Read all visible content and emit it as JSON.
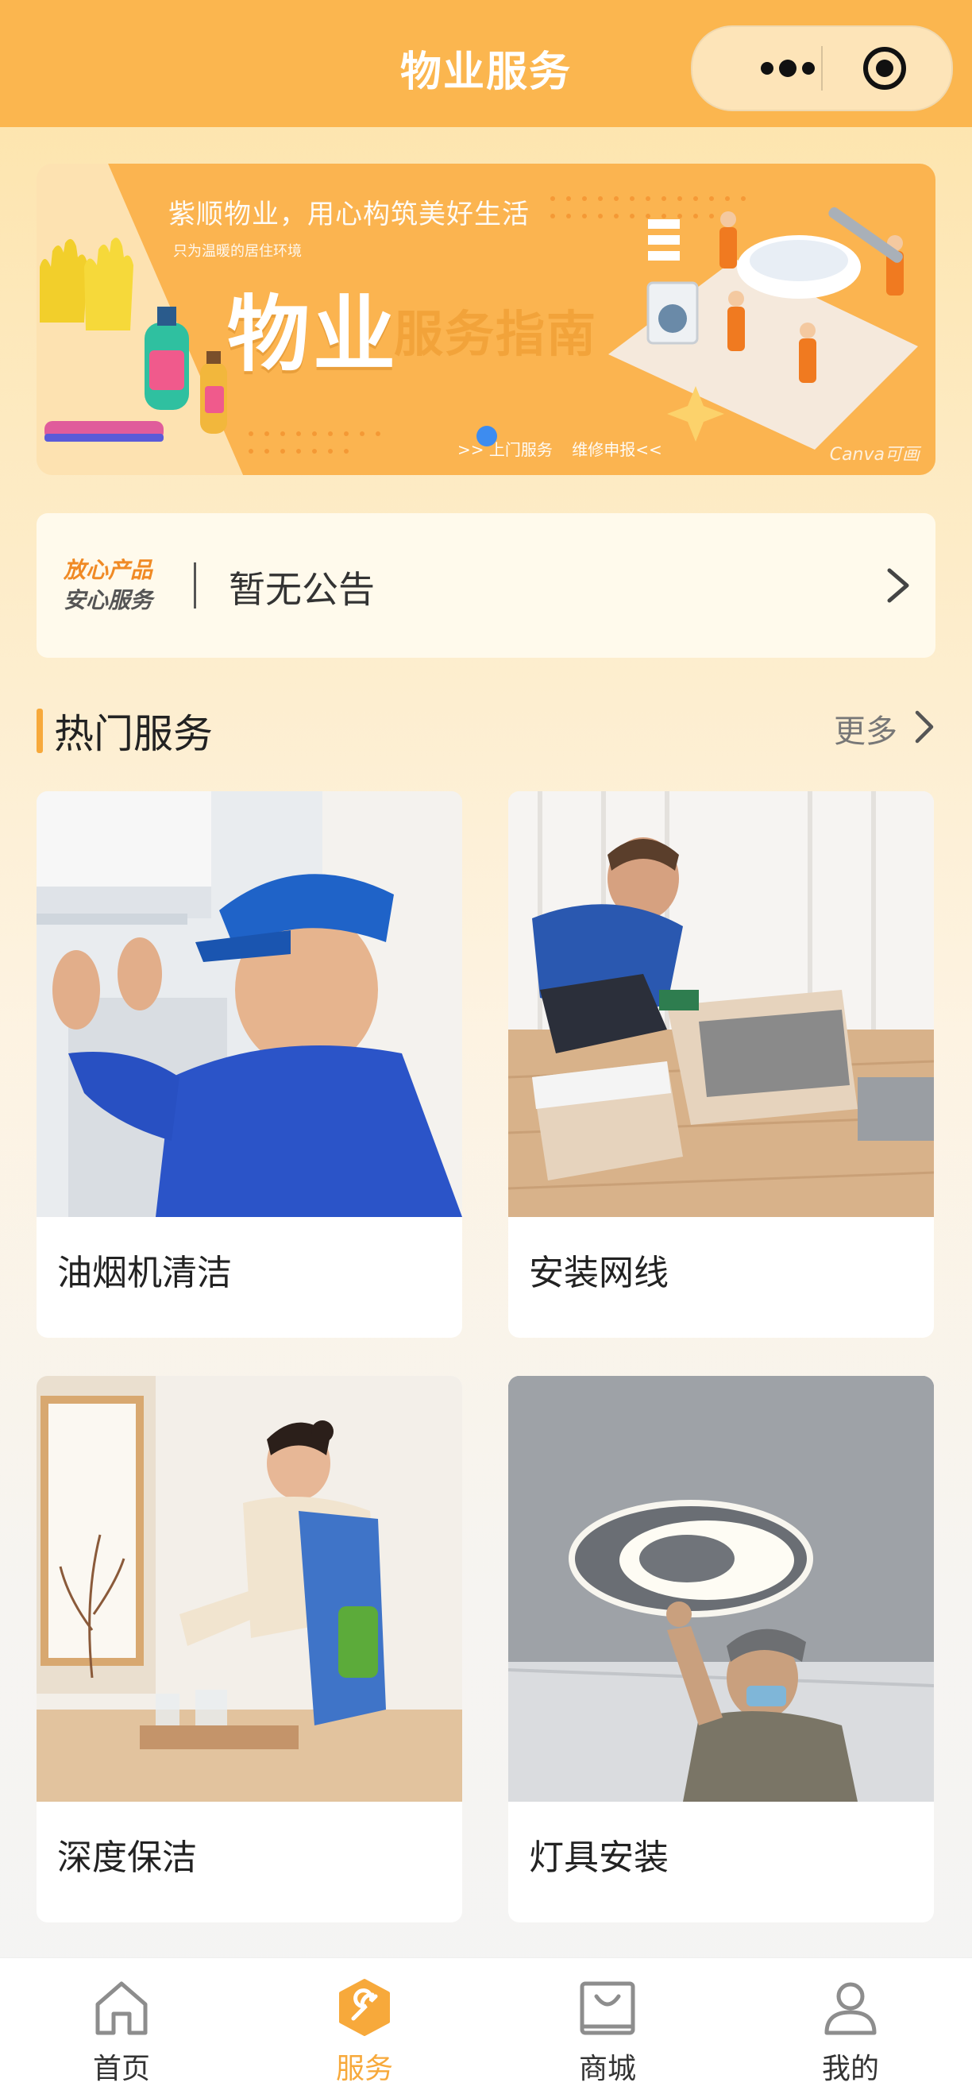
{
  "header": {
    "title": "物业服务"
  },
  "banner": {
    "slogan": "紫顺物业，用心构筑美好生活",
    "subtitle": "只为温暖的居住环境",
    "title_big": "物业",
    "title_small": "服务指南",
    "links": [
      ">> 上门服务",
      "维修申报<<"
    ],
    "watermark": "Canva可画"
  },
  "notice": {
    "tag_line1": "放心产品",
    "tag_line2": "安心服务",
    "text": "暂无公告"
  },
  "section": {
    "title": "热门服务",
    "more_label": "更多"
  },
  "services": [
    {
      "label": "油烟机清洁"
    },
    {
      "label": "安装网线"
    },
    {
      "label": "深度保洁"
    },
    {
      "label": "灯具安装"
    }
  ],
  "tabbar": {
    "items": [
      {
        "label": "首页",
        "icon": "home-icon"
      },
      {
        "label": "服务",
        "icon": "wrench-icon"
      },
      {
        "label": "商城",
        "icon": "shop-bag-icon"
      },
      {
        "label": "我的",
        "icon": "user-icon"
      }
    ]
  },
  "colors": {
    "nav_bg": "#fbb64f",
    "accent": "#f7a93b",
    "dot_active": "#3d8cf0"
  }
}
